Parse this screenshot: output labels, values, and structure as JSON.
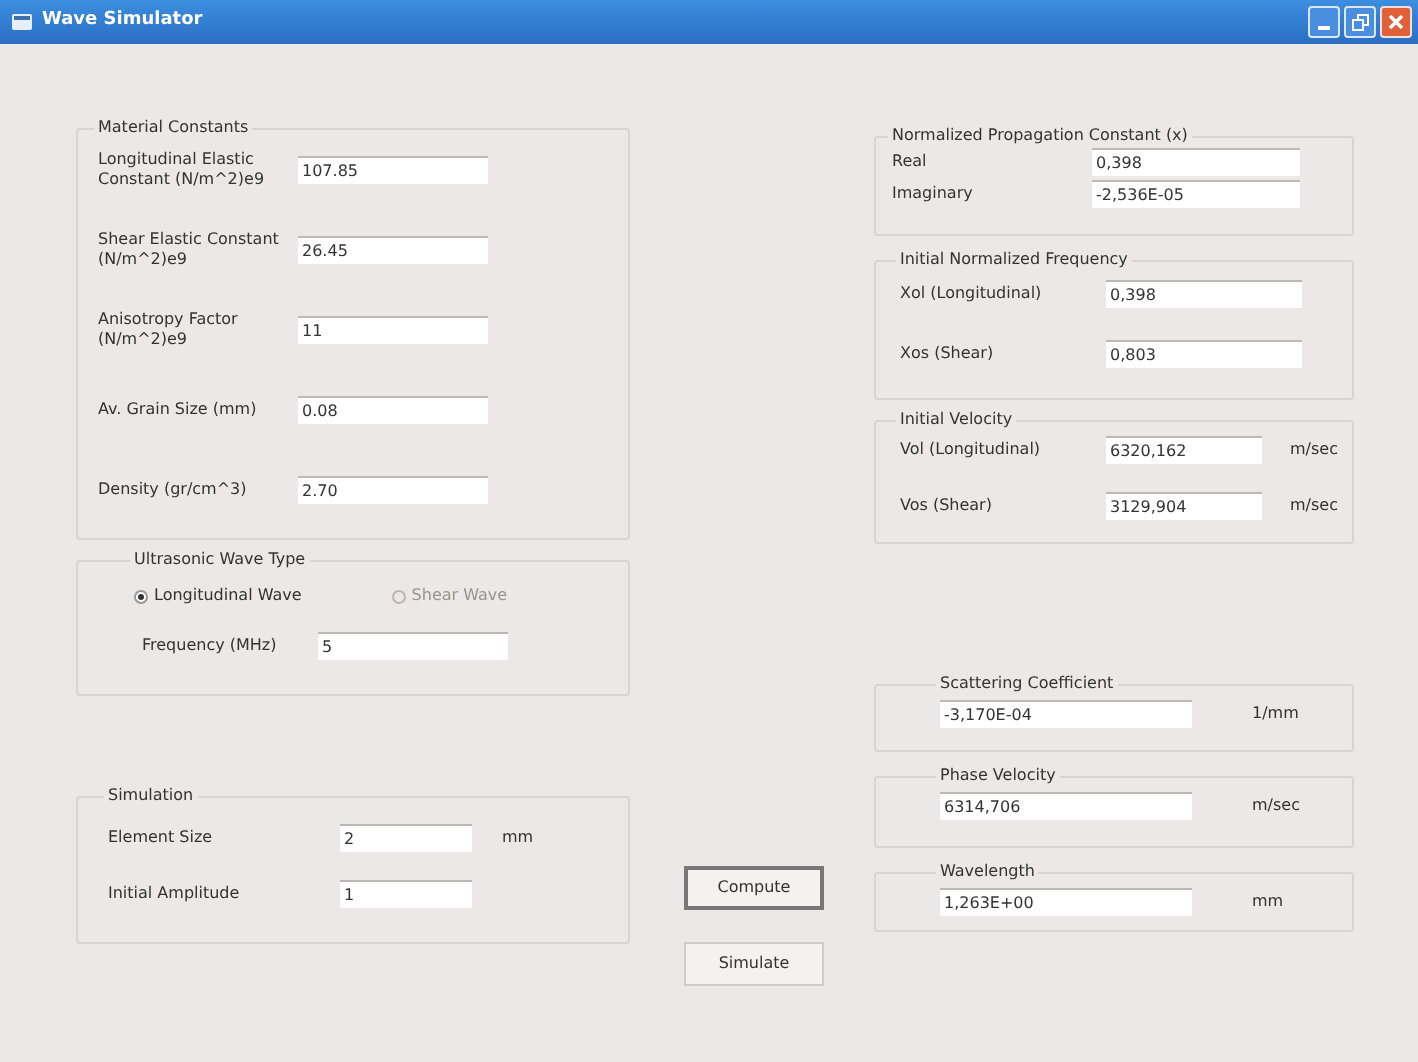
{
  "window": {
    "title": "Wave Simulator"
  },
  "material_constants": {
    "title": "Material Constants",
    "rows": [
      {
        "label": "Longitudinal Elastic Constant (N/m^2)e9",
        "value": "107.85"
      },
      {
        "label": "Shear Elastic Constant (N/m^2)e9",
        "value": "26.45"
      },
      {
        "label": "Anisotropy Factor (N/m^2)e9",
        "value": "11"
      },
      {
        "label": "Av. Grain Size (mm)",
        "value": "0.08"
      },
      {
        "label": "Density (gr/cm^3)",
        "value": "2.70"
      }
    ]
  },
  "wave_type": {
    "title": "Ultrasonic Wave Type",
    "radios": [
      {
        "label": "Longitudinal Wave",
        "selected": true,
        "disabled": false
      },
      {
        "label": "Shear Wave",
        "selected": false,
        "disabled": true
      }
    ],
    "frequency": {
      "label": "Frequency (MHz)",
      "value": "5"
    }
  },
  "simulation": {
    "title": "Simulation",
    "rows": [
      {
        "label": "Element Size",
        "value": "2",
        "unit": "mm"
      },
      {
        "label": "Initial Amplitude",
        "value": "1"
      }
    ]
  },
  "buttons": [
    {
      "label": "Compute",
      "focused": true
    },
    {
      "label": "Simulate",
      "focused": false
    }
  ],
  "right_groups": [
    {
      "title": "Normalized Propagation Constant (x)",
      "rows": [
        {
          "label": "Real",
          "value": "0,398"
        },
        {
          "label": "Imaginary",
          "value": "-2,536E-05"
        }
      ]
    },
    {
      "title": "Initial Normalized Frequency",
      "rows": [
        {
          "label": "Xol (Longitudinal)",
          "value": "0,398"
        },
        {
          "label": "Xos (Shear)",
          "value": "0,803"
        }
      ]
    },
    {
      "title": "Initial Velocity",
      "rows": [
        {
          "label": "Vol (Longitudinal)",
          "value": "6320,162",
          "unit": "m/sec"
        },
        {
          "label": "Vos (Shear)",
          "value": "3129,904",
          "unit": "m/sec"
        }
      ]
    },
    {
      "title": "Scattering Coefficient",
      "rows": [
        {
          "value": "-3,170E-04",
          "unit": "1/mm"
        }
      ]
    },
    {
      "title": "Phase Velocity",
      "rows": [
        {
          "value": "6314,706",
          "unit": "m/sec"
        }
      ]
    },
    {
      "title": "Wavelength",
      "rows": [
        {
          "value": "1,263E+00",
          "unit": "mm"
        }
      ]
    }
  ]
}
